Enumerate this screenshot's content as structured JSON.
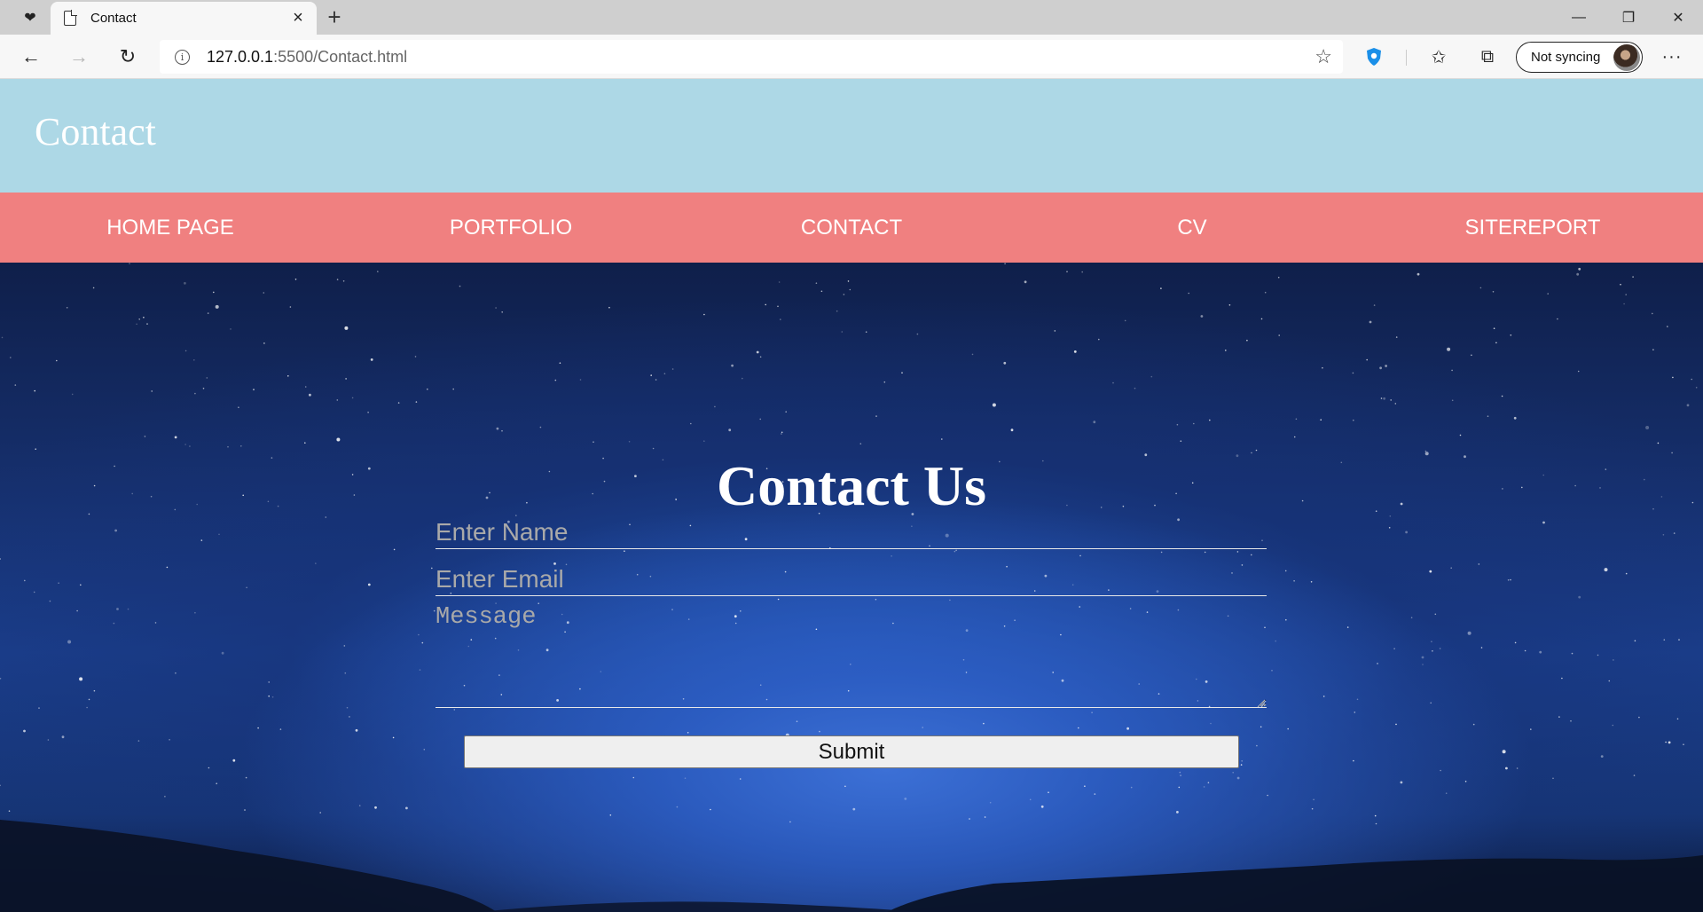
{
  "browser": {
    "tab_title": "Contact",
    "url_host": "127.0.0.1",
    "url_path": ":5500/Contact.html",
    "sync_label": "Not syncing"
  },
  "site": {
    "header_title": "Contact",
    "nav": [
      "HOME PAGE",
      "PORTFOLIO",
      "CONTACT",
      "CV",
      "SITEREPORT"
    ]
  },
  "form": {
    "title": "Contact Us",
    "name_placeholder": "Enter Name",
    "email_placeholder": "Enter Email",
    "message_placeholder": "Message",
    "submit_label": "Submit"
  }
}
